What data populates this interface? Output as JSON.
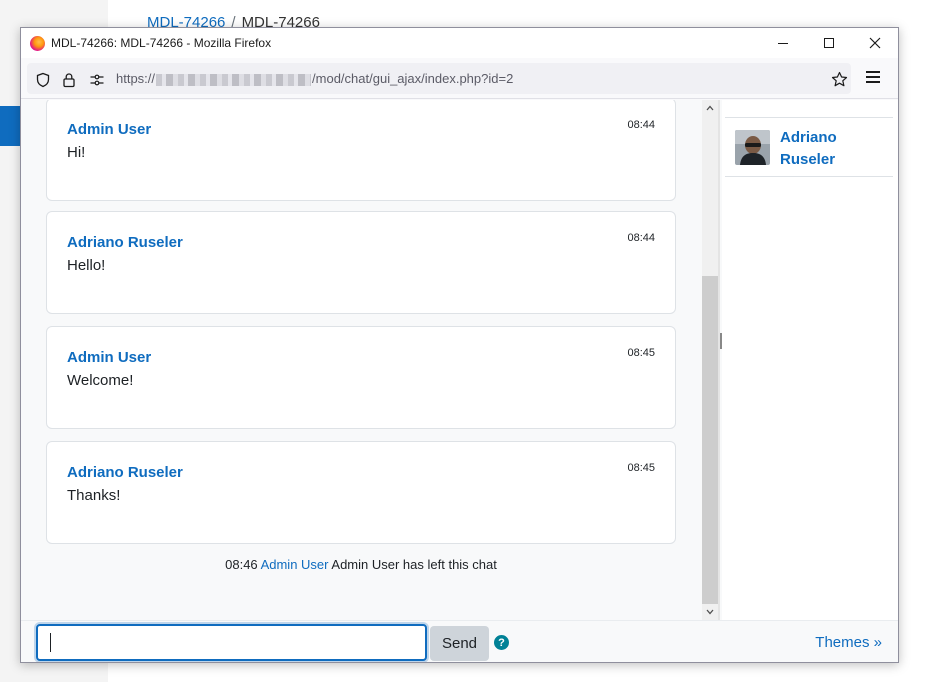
{
  "background": {
    "breadcrumb_link": "MDL-74266",
    "breadcrumb_separator": "/",
    "breadcrumb_current": "MDL-74266"
  },
  "window": {
    "title": "MDL-74266: MDL-74266 - Mozilla Firefox",
    "url_prefix": "https://",
    "url_suffix": "/mod/chat/gui_ajax/index.php?id=2"
  },
  "icons": {
    "browser_logo": "firefox-logo",
    "shield": "shield-icon",
    "lock": "lock-icon",
    "permissions": "permissions-icon",
    "bookmark": "star-icon",
    "menu": "hamburger-menu-icon",
    "help": "question-circle-icon"
  },
  "messages": [
    {
      "user": "Admin User",
      "time": "08:44",
      "text": "Hi!"
    },
    {
      "user": "Adriano Ruseler",
      "time": "08:44",
      "text": "Hello!"
    },
    {
      "user": "Admin User",
      "time": "08:45",
      "text": "Welcome!"
    },
    {
      "user": "Adriano Ruseler",
      "time": "08:45",
      "text": "Thanks!"
    }
  ],
  "system_event": {
    "time": "08:46",
    "user": "Admin User",
    "text": "Admin User has left this chat"
  },
  "users": [
    {
      "name": "Adriano Ruseler"
    }
  ],
  "input": {
    "value": "",
    "send_label": "Send",
    "help_glyph": "?"
  },
  "themes_label": "Themes »",
  "colors": {
    "link": "#0f6cbf",
    "focus_border": "#0f6cbf",
    "help": "#008196",
    "send_bg": "#ced4da"
  }
}
